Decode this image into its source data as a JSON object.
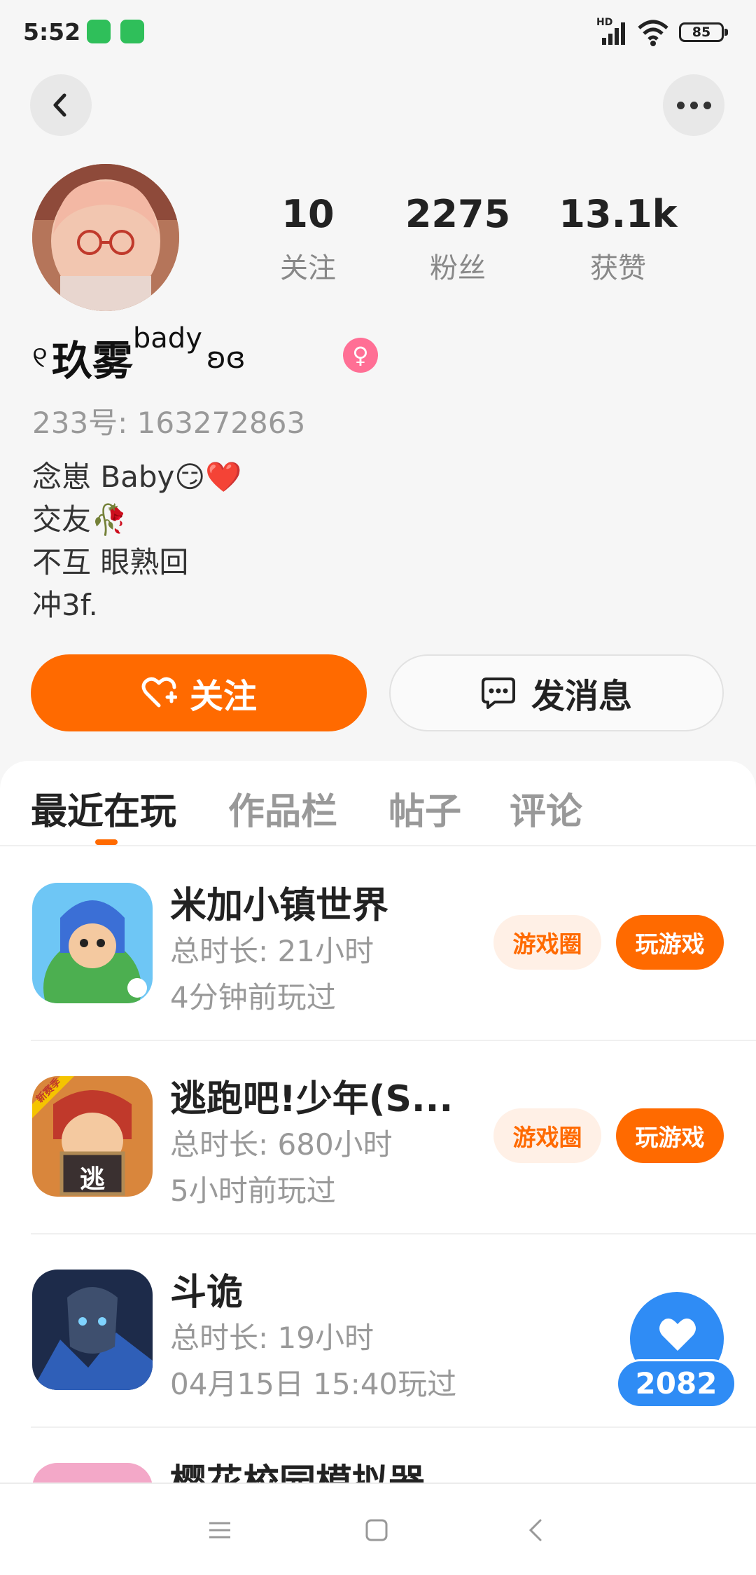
{
  "status": {
    "time": "5:52",
    "network": "HD",
    "battery": "85"
  },
  "profile": {
    "avatar_alt": "avatar",
    "stats": [
      {
        "num": "10",
        "label": "关注"
      },
      {
        "num": "2275",
        "label": "粉丝"
      },
      {
        "num": "13.1k",
        "label": "获赞"
      }
    ],
    "name_deco_left": "୧",
    "name": "玖雾",
    "name_sup": "bady",
    "name_deco_right": "ʚɞ",
    "gender_symbol": "♀",
    "uid": "233号: 163272863",
    "bio": [
      "念崽 Baby😏❤️",
      "交友🥀",
      "不互  眼熟回",
      "冲3f."
    ]
  },
  "actions": {
    "follow": "关注",
    "message": "发消息"
  },
  "tabs": [
    "最近在玩",
    "作品栏",
    "帖子",
    "评论"
  ],
  "games": [
    {
      "title": "米加小镇世界",
      "duration": "总时长: 21小时",
      "last_played": "4分钟前玩过",
      "circle": "游戏圈",
      "play": "玩游戏"
    },
    {
      "title": "逃跑吧!少年(S...",
      "duration": "总时长: 680小时",
      "last_played": "5小时前玩过",
      "circle": "游戏圈",
      "play": "玩游戏",
      "icon_text": "逃",
      "badge": "新赛季"
    },
    {
      "title": "斗诡",
      "duration": "总时长: 19小时",
      "last_played": "04月15日 15:40玩过"
    },
    {
      "title": "樱花校园模拟器"
    }
  ],
  "float_like": {
    "count": "2082"
  },
  "colors": {
    "accent": "#ff6a00",
    "blue": "#2f8cf5",
    "pink": "#ff6f95"
  }
}
